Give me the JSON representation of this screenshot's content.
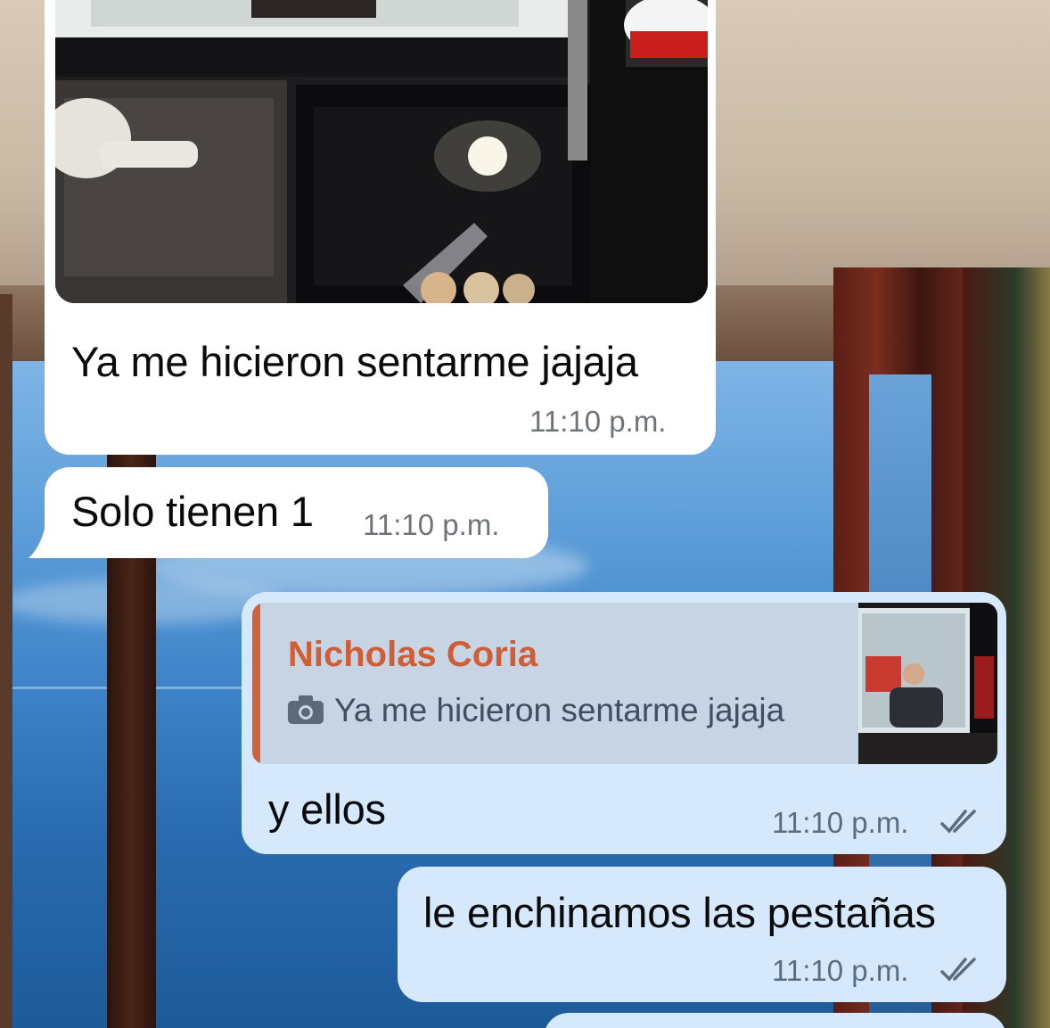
{
  "messages": [
    {
      "id": "photo_message",
      "direction": "incoming",
      "has_photo": true,
      "text": "Ya me hicieron sentarme jajaja",
      "time": "11:10 p.m."
    },
    {
      "id": "solo_message",
      "direction": "incoming",
      "text": "Solo tienen 1",
      "time": "11:10 p.m."
    },
    {
      "id": "reply_message",
      "direction": "outgoing",
      "reply_to": {
        "sender": "Nicholas Coria",
        "icon": "camera-icon",
        "text": "Ya me hicieron sentarme jajaja"
      },
      "text": "y ellos",
      "time": "11:10 p.m.",
      "status": "read-double-check"
    },
    {
      "id": "pestanas_message",
      "direction": "outgoing",
      "text": "le enchinamos las pestañas",
      "time": "11:10 p.m.",
      "status": "read-double-check"
    }
  ],
  "colors": {
    "incoming_bubble": "#ffffff",
    "outgoing_bubble": "#d6e8fb",
    "reply_accent": "#d4603a",
    "reply_background": "#c6d4e4"
  }
}
